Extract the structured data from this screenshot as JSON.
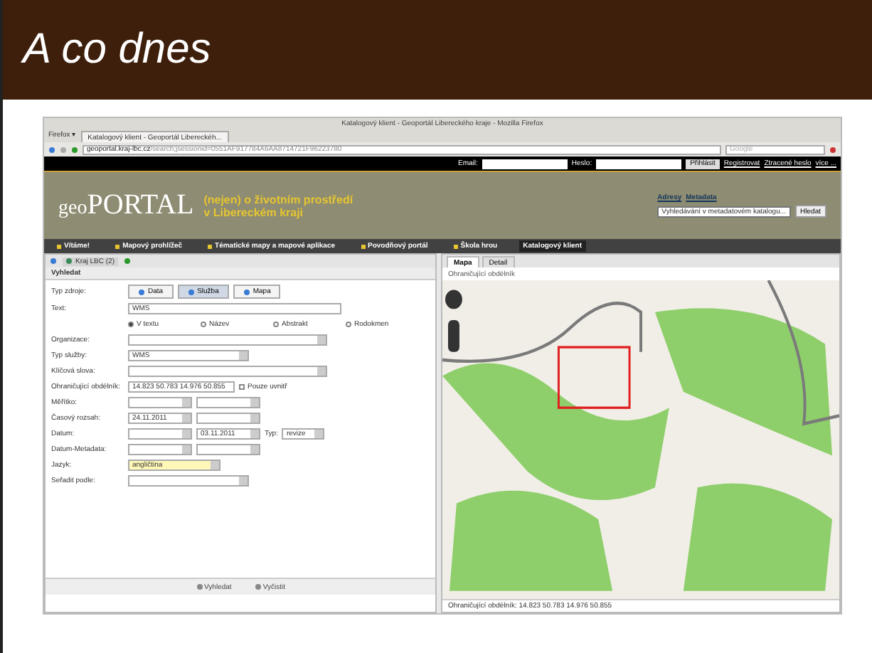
{
  "slide": {
    "title": "A co dnes"
  },
  "browser": {
    "title": "Katalogový klient - Geoportál Libereckého kraje - Mozilla Firefox",
    "menu": "Firefox ▾",
    "tabs": [
      {
        "label": "Katalogový klient - Geoportál Libereckéh...",
        "selected": true
      }
    ],
    "url_host": "geoportal.kraj-lbc.cz",
    "url_path": "/search;jsessionid=0551AF917784A6AA8714721F96223780",
    "search_placeholder": "Google"
  },
  "site": {
    "email_label": "Email:",
    "password_label": "Heslo:",
    "login_button": "Přihlásit",
    "links": [
      "Registrovat",
      "Ztracené heslo",
      "více ..."
    ],
    "logo_geo": "geo",
    "logo_portal": "PORTAL",
    "tagline": [
      "(nejen) o životním prostředí",
      "v Libereckém kraji"
    ],
    "search_links": [
      "Adresy",
      "Metadata"
    ],
    "search_value": "Vyhledávání v metadatovém katalogu...",
    "search_button": "Hledat",
    "nav": [
      {
        "label": "Vítáme!",
        "selected": false
      },
      {
        "label": "Mapový prohlížeč",
        "selected": false
      },
      {
        "label": "Tématické mapy a mapové aplikace",
        "selected": false
      },
      {
        "label": "Povodňový portál",
        "selected": false
      },
      {
        "label": "Škola hrou",
        "selected": false
      },
      {
        "label": "Katalogový klient",
        "selected": true
      }
    ]
  },
  "left_toolbar": {
    "tab": "Kraj LBC (2)"
  },
  "form": {
    "title": "Vyhledat",
    "rows": [
      {
        "label": "Typ zdroje:",
        "fields": [
          {
            "kind": "segment",
            "text": "Data",
            "selected": false
          },
          {
            "kind": "segment",
            "text": "Služba",
            "selected": true
          },
          {
            "kind": "segment",
            "text": "Mapa",
            "selected": false
          }
        ]
      },
      {
        "label": "Text:",
        "fields": [
          {
            "kind": "input_wide",
            "text": "WMS"
          }
        ]
      },
      {
        "label": "",
        "fields": [
          {
            "kind": "radio",
            "text": "V textu",
            "selected": true
          },
          {
            "kind": "radio",
            "text": "Název",
            "selected": false
          },
          {
            "kind": "radio",
            "text": "Abstrakt",
            "selected": false
          },
          {
            "kind": "radio",
            "text": "Rodokmen",
            "selected": false
          }
        ]
      },
      {
        "label": "Organizace:",
        "fields": [
          {
            "kind": "select_wide"
          }
        ]
      },
      {
        "label": "Typ služby:",
        "fields": [
          {
            "kind": "select_mid",
            "text": "WMS"
          }
        ]
      },
      {
        "label": "Klíčová slova:",
        "fields": [
          {
            "kind": "select_wide"
          }
        ]
      },
      {
        "label": "Ohraničující obdélník:",
        "fields": [
          {
            "kind": "input",
            "text": "14.823 50.783 14.976 50.855"
          },
          {
            "kind": "checkbox",
            "text": "Pouze uvnitř",
            "checked": false
          }
        ]
      },
      {
        "label": "Měřítko:",
        "fields": [
          {
            "kind": "select"
          },
          {
            "kind": "select"
          }
        ]
      },
      {
        "label": "Časový rozsah:",
        "fields": [
          {
            "kind": "date",
            "text": "24.11.2011"
          },
          {
            "kind": "date"
          }
        ]
      },
      {
        "label": "Datum:",
        "fields": [
          {
            "kind": "date"
          },
          {
            "kind": "date",
            "text": "03.11.2011"
          },
          {
            "kind": "caption",
            "text": "Typ:"
          },
          {
            "kind": "select_small",
            "text": "revize"
          }
        ]
      },
      {
        "label": "Datum-Metadata:",
        "fields": [
          {
            "kind": "date"
          },
          {
            "kind": "date"
          }
        ]
      },
      {
        "label": "Jazyk:",
        "fields": [
          {
            "kind": "select_focus",
            "text": "angličtina"
          }
        ]
      },
      {
        "label": "Seřadit podle:",
        "fields": [
          {
            "kind": "select_mid"
          }
        ]
      }
    ],
    "buttons": [
      "Vyhledat",
      "Vyčistit"
    ]
  },
  "map_panel": {
    "tabs": [
      {
        "label": "Mapa",
        "selected": true
      },
      {
        "label": "Detail",
        "selected": false
      }
    ],
    "header": "Ohraničující obdélník",
    "footer": "Ohraničující obdélník: 14.823 50.783 14.976 50.855"
  }
}
